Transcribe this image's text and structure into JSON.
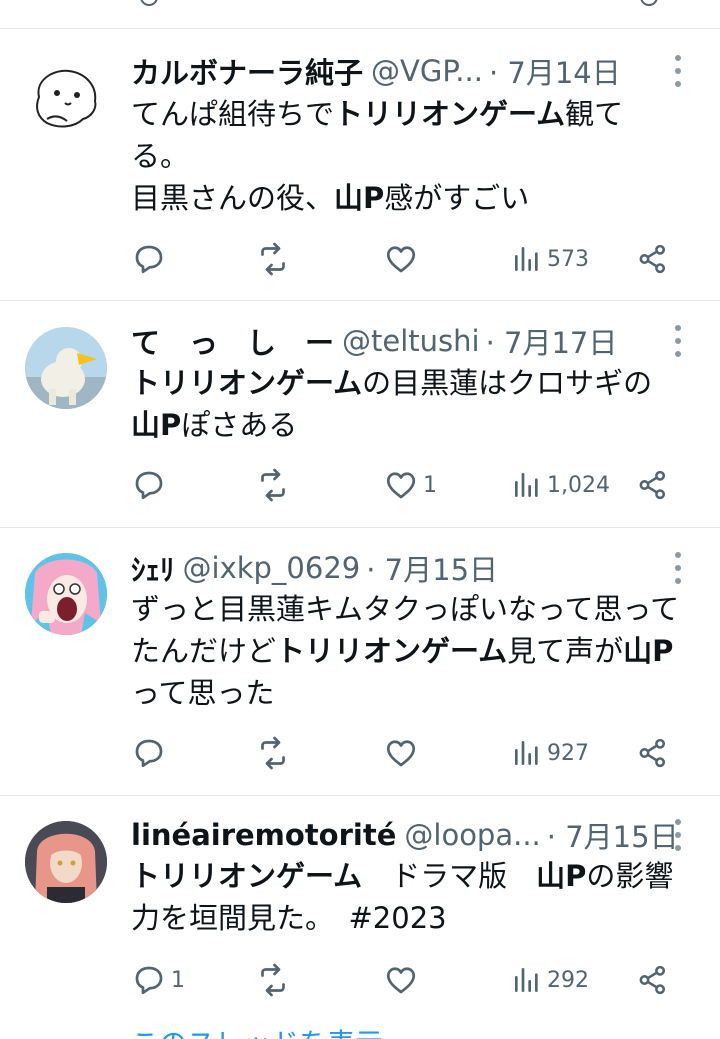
{
  "colors": {
    "text": "#0f1419",
    "muted": "#536471",
    "link": "#1d9bf0",
    "divider": "#e6e9ec"
  },
  "tweets": [
    {
      "name": "カルボナーラ純子",
      "handle": "@VGP...",
      "date": "· 7月14日",
      "body": [
        {
          "t": "てんぱ組待ちで",
          "b": false
        },
        {
          "t": "トリリオンゲーム",
          "b": true
        },
        {
          "t": "観てる。",
          "b": false
        },
        {
          "br": true
        },
        {
          "t": "目黒さんの役、",
          "b": false
        },
        {
          "t": "山P",
          "b": true
        },
        {
          "t": "感がすごい",
          "b": false
        }
      ],
      "reply_count": "",
      "like_count": "",
      "views": "573",
      "avatar": "seal-drawing"
    },
    {
      "name": "て　っ　し　ー",
      "handle": "@teltushi",
      "date": "· 7月17日",
      "body": [
        {
          "t": "トリリオンゲーム",
          "b": true
        },
        {
          "t": "の目黒蓮はクロサギの",
          "b": false
        },
        {
          "t": "山P",
          "b": true
        },
        {
          "t": "ぽさある",
          "b": false
        }
      ],
      "reply_count": "",
      "like_count": "1",
      "views": "1,024",
      "avatar": "polar-bear-photo"
    },
    {
      "name": "ｼｪﾘ",
      "handle": "@ixkp_0629",
      "date": "· 7月15日",
      "body": [
        {
          "t": "ずっと目黒蓮キムタクっぽいなって思ってたんだけど",
          "b": false
        },
        {
          "t": "トリリオンゲーム",
          "b": true
        },
        {
          "t": "見て声が",
          "b": false
        },
        {
          "t": "山P",
          "b": true
        },
        {
          "t": "って思った",
          "b": false
        }
      ],
      "reply_count": "",
      "like_count": "",
      "views": "927",
      "avatar": "anime-girl-pink"
    },
    {
      "name": "linéairemotorité",
      "handle": "@loopa...",
      "date": "· 7月15日",
      "body": [
        {
          "t": "トリリオンゲーム",
          "b": true
        },
        {
          "t": "　ドラマ版　",
          "b": false
        },
        {
          "t": "山P",
          "b": true
        },
        {
          "t": "の影響力を垣間見た。　#2023",
          "b": false
        }
      ],
      "reply_count": "1",
      "like_count": "",
      "views": "292",
      "avatar": "anime-girl-brown"
    }
  ],
  "show_thread": "このスレッドを表示"
}
